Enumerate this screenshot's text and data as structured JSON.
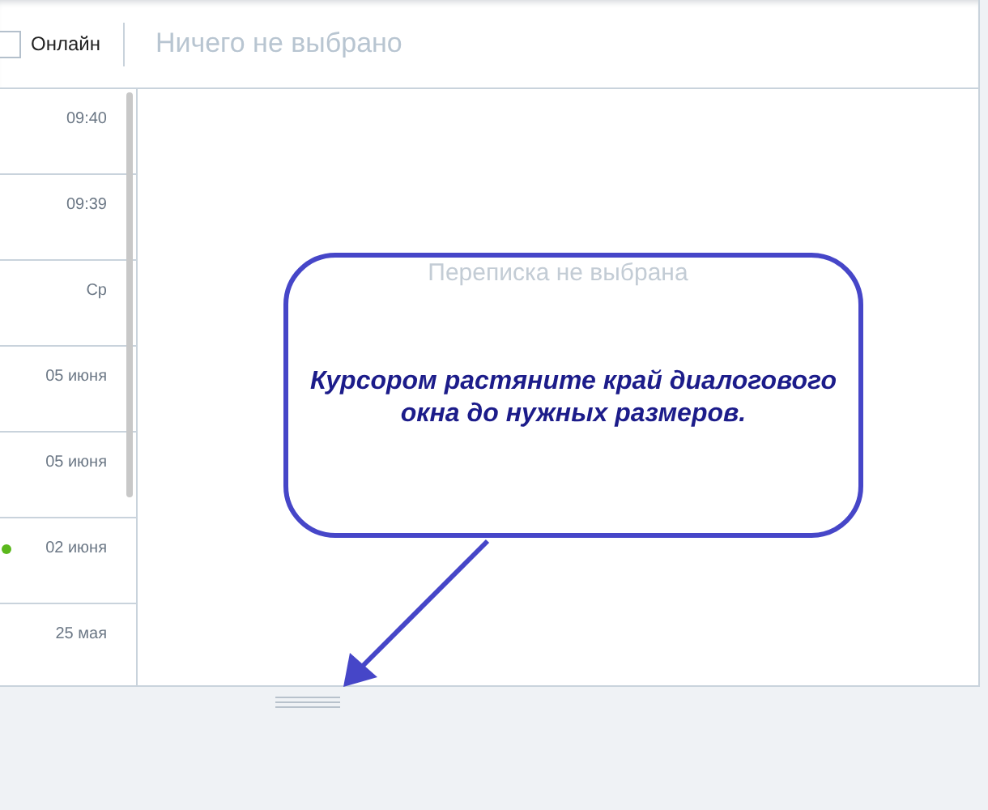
{
  "header": {
    "online_filter": {
      "label": "Онлайн",
      "checked": false
    },
    "selection_title": "Ничего не выбрано"
  },
  "conversations": [
    {
      "time": "09:40",
      "online": false
    },
    {
      "time": "09:39",
      "online": false
    },
    {
      "time": "Ср",
      "online": false
    },
    {
      "time": "05 июня",
      "online": false
    },
    {
      "time": "05 июня",
      "online": false
    },
    {
      "time": "02 июня",
      "online": true
    },
    {
      "time": "25 мая",
      "online": false
    }
  ],
  "empty_state": "Переписка не выбрана",
  "callout": {
    "text": "Курсором растяните край диалогового окна до нужных размеров."
  }
}
